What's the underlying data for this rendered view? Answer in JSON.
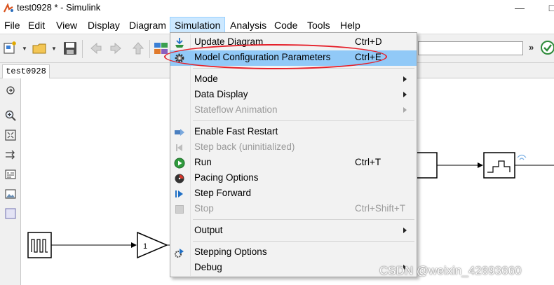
{
  "window": {
    "title": "test0928 * - Simulink",
    "minimize_glyph": "—",
    "maximize_glyph": "□"
  },
  "menubar": {
    "items": [
      {
        "label": "File"
      },
      {
        "label": "Edit"
      },
      {
        "label": "View"
      },
      {
        "label": "Display"
      },
      {
        "label": "Diagram"
      },
      {
        "label": "Simulation"
      },
      {
        "label": "Analysis"
      },
      {
        "label": "Code"
      },
      {
        "label": "Tools"
      },
      {
        "label": "Help"
      }
    ],
    "active": "Simulation"
  },
  "toolbar": {
    "icons": [
      "new-model-icon",
      "open-folder-icon",
      "save-icon",
      "back-icon",
      "forward-icon",
      "up-icon",
      "library-browser-icon",
      "check-icon"
    ],
    "more_glyph": "»"
  },
  "tabs": {
    "model_tab": "test0928"
  },
  "palette": {
    "icons": [
      "hide-show-icon",
      "zoom-icon",
      "fit-view-icon",
      "arrow-route-icon",
      "annotation-icon",
      "image-icon",
      "area-icon"
    ]
  },
  "canvas": {
    "gain_value": "1"
  },
  "simulation_menu": {
    "items": [
      {
        "label": "Update Diagram",
        "shortcut": "Ctrl+D",
        "icon": "update-diagram-icon"
      },
      {
        "label": "Model Configuration Parameters",
        "shortcut": "Ctrl+E",
        "icon": "gear-icon",
        "highlighted": true
      },
      {
        "label": "Mode",
        "submenu": true
      },
      {
        "label": "Data Display",
        "submenu": true
      },
      {
        "label": "Stateflow Animation",
        "submenu": true,
        "disabled": true
      },
      {
        "label": "Enable Fast Restart",
        "icon": "fast-restart-icon"
      },
      {
        "label": "Step back (uninitialized)",
        "icon": "step-back-icon",
        "disabled": true
      },
      {
        "label": "Run",
        "shortcut": "Ctrl+T",
        "icon": "run-icon"
      },
      {
        "label": "Pacing Options",
        "icon": "pacing-icon"
      },
      {
        "label": "Step Forward",
        "icon": "step-forward-icon"
      },
      {
        "label": "Stop",
        "shortcut": "Ctrl+Shift+T",
        "icon": "stop-icon",
        "disabled": true
      },
      {
        "label": "Output",
        "submenu": true
      },
      {
        "label": "Stepping Options",
        "icon": "stepping-options-icon"
      },
      {
        "label": "Debug",
        "submenu": true
      }
    ]
  },
  "watermark": "CSDN @weixin_42693660",
  "colors": {
    "highlight": "#91c9f7",
    "annotation": "#e5202a",
    "menu_active": "#cce8ff"
  }
}
